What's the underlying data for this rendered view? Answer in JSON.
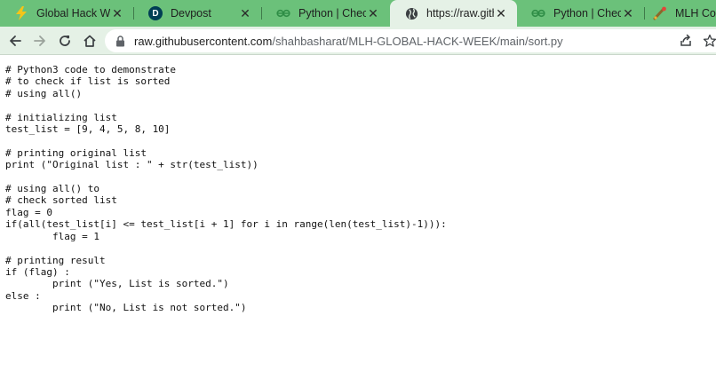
{
  "browser": {
    "tabs": [
      {
        "title": "Global Hack Week",
        "favicon": "lightning-icon",
        "active": false
      },
      {
        "title": "Devpost",
        "favicon": "devpost-icon",
        "active": false
      },
      {
        "title": "Python | Check if lis",
        "favicon": "geeksforgeeks-icon",
        "active": false
      },
      {
        "title": "https://raw.githubu",
        "favicon": "globe-icon",
        "active": true
      },
      {
        "title": "Python | Check if lis",
        "favicon": "geeksforgeeks-icon",
        "active": false
      },
      {
        "title": "MLH Comm",
        "favicon": "mlh-icon",
        "active": false
      }
    ],
    "tab_close_glyph": "✕",
    "devpost_letter": "D",
    "address_bar": {
      "host": "raw.githubusercontent.com",
      "path": "/shahbasharat/MLH-GLOBAL-HACK-WEEK/main/sort.py"
    },
    "colors": {
      "tabstrip": "#6bc17a",
      "toolbar": "#e5f1e6"
    }
  },
  "file": {
    "lines": [
      "# Python3 code to demonstrate",
      "# to check if list is sorted",
      "# using all()",
      "",
      "# initializing list",
      "test_list = [9, 4, 5, 8, 10]",
      "",
      "# printing original list",
      "print (\"Original list : \" + str(test_list))",
      "",
      "# using all() to",
      "# check sorted list",
      "flag = 0",
      "if(all(test_list[i] <= test_list[i + 1] for i in range(len(test_list)-1))):",
      "        flag = 1",
      "",
      "# printing result",
      "if (flag) :",
      "        print (\"Yes, List is sorted.\")",
      "else :",
      "        print (\"No, List is not sorted.\")"
    ]
  }
}
